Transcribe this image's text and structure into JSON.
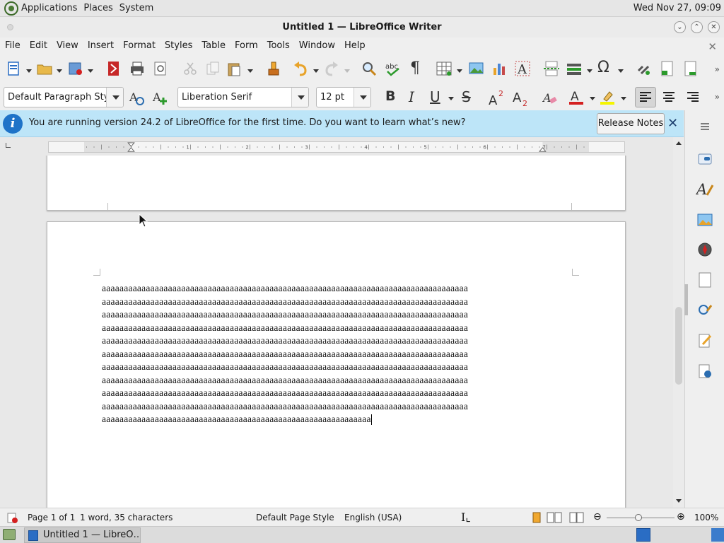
{
  "top_panel": {
    "menus": [
      "Applications",
      "Places",
      "System"
    ],
    "clock": "Wed Nov 27, 09:09"
  },
  "window": {
    "title": "Untitled 1 — LibreOffice Writer",
    "buttons": [
      "minimize-icon",
      "maximize-icon",
      "close-icon"
    ]
  },
  "menubar": [
    "File",
    "Edit",
    "View",
    "Insert",
    "Format",
    "Styles",
    "Table",
    "Form",
    "Tools",
    "Window",
    "Help"
  ],
  "formatting": {
    "paragraph_style": "Default Paragraph Style",
    "font_name": "Liberation Serif",
    "font_size": "12 pt",
    "bold": "B",
    "italic": "I",
    "underline": "U",
    "strikethrough": "S"
  },
  "infobar": {
    "message": "You are running version 24.2 of LibreOffice for the first time. Do you want to learn what’s new?",
    "button": "Release Notes"
  },
  "document": {
    "lines": [
      "aaaaaaaaaaaaaaaaaaaaaaaaaaaaaaaaaaaaaaaaaaaaaaaaaaaaaaaaaaaaaaaaaaaaaaaaaaaaaaaaaaa",
      "aaaaaaaaaaaaaaaaaaaaaaaaaaaaaaaaaaaaaaaaaaaaaaaaaaaaaaaaaaaaaaaaaaaaaaaaaaaaaaaaaaa",
      "aaaaaaaaaaaaaaaaaaaaaaaaaaaaaaaaaaaaaaaaaaaaaaaaaaaaaaaaaaaaaaaaaaaaaaaaaaaaaaaaaaa",
      "aaaaaaaaaaaaaaaaaaaaaaaaaaaaaaaaaaaaaaaaaaaaaaaaaaaaaaaaaaaaaaaaaaaaaaaaaaaaaaaaaaa",
      "aaaaaaaaaaaaaaaaaaaaaaaaaaaaaaaaaaaaaaaaaaaaaaaaaaaaaaaaaaaaaaaaaaaaaaaaaaaaaaaaaaa",
      "aaaaaaaaaaaaaaaaaaaaaaaaaaaaaaaaaaaaaaaaaaaaaaaaaaaaaaaaaaaaaaaaaaaaaaaaaaaaaaaaaaa",
      "aaaaaaaaaaaaaaaaaaaaaaaaaaaaaaaaaaaaaaaaaaaaaaaaaaaaaaaaaaaaaaaaaaaaaaaaaaaaaaaaaaa",
      "aaaaaaaaaaaaaaaaaaaaaaaaaaaaaaaaaaaaaaaaaaaaaaaaaaaaaaaaaaaaaaaaaaaaaaaaaaaaaaaaaaa",
      "aaaaaaaaaaaaaaaaaaaaaaaaaaaaaaaaaaaaaaaaaaaaaaaaaaaaaaaaaaaaaaaaaaaaaaaaaaaaaaaaaaa",
      "aaaaaaaaaaaaaaaaaaaaaaaaaaaaaaaaaaaaaaaaaaaaaaaaaaaaaaaaaaaaaaaaaaaaaaaaaaaaaaaaaaa",
      "aaaaaaaaaaaaaaaaaaaaaaaaaaaaaaaaaaaaaaaaaaaaaaaaaaaaaaaaaaaaa"
    ]
  },
  "statusbar": {
    "page": "Page 1 of 1",
    "word_count": "1 word, 35 characters",
    "page_style": "Default Page Style",
    "language": "English (USA)",
    "zoom": "100%"
  },
  "taskbar": {
    "task_label": "Untitled 1 — LibreO…"
  },
  "colors": {
    "infobar_bg": "#bde5f8",
    "info_icon": "#1e73c8",
    "font_color_red": "#d42020",
    "highlight_yellow": "#f5f500"
  }
}
